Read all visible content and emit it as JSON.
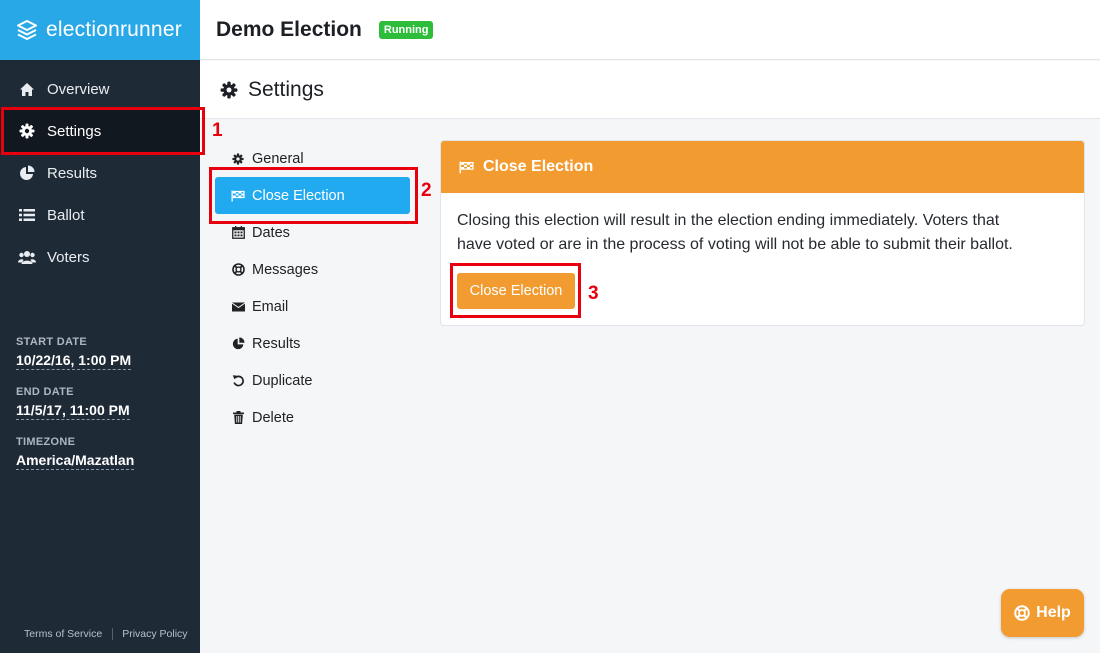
{
  "app": {
    "logo_text": "electionrunner"
  },
  "sidebar": {
    "items": [
      {
        "label": "Overview",
        "icon": "home-icon"
      },
      {
        "label": "Settings",
        "icon": "gear-icon",
        "active": true
      },
      {
        "label": "Results",
        "icon": "pie-chart-icon"
      },
      {
        "label": "Ballot",
        "icon": "list-icon"
      },
      {
        "label": "Voters",
        "icon": "users-icon"
      }
    ],
    "meta": {
      "start_label": "START DATE",
      "start_value": "10/22/16, 1:00 PM",
      "end_label": "END DATE",
      "end_value": "11/5/17, 11:00 PM",
      "tz_label": "TIMEZONE",
      "tz_value": "America/Mazatlan"
    },
    "footer": {
      "terms": "Terms of Service",
      "privacy": "Privacy Policy"
    }
  },
  "header": {
    "title": "Demo Election",
    "status": "Running"
  },
  "page": {
    "title": "Settings"
  },
  "subnav": {
    "items": [
      {
        "label": "General",
        "icon": "gear-icon"
      },
      {
        "label": "Close Election",
        "icon": "flag-icon",
        "active": true
      },
      {
        "label": "Dates",
        "icon": "calendar-icon"
      },
      {
        "label": "Messages",
        "icon": "lifebuoy-icon"
      },
      {
        "label": "Email",
        "icon": "envelope-icon"
      },
      {
        "label": "Results",
        "icon": "pie-chart-icon"
      },
      {
        "label": "Duplicate",
        "icon": "undo-icon"
      },
      {
        "label": "Delete",
        "icon": "trash-icon"
      }
    ]
  },
  "panel": {
    "title": "Close Election",
    "line1": "Closing this election will result in the election ending immediately. Voters that",
    "line2": "have voted or are in the process of voting will not be able to submit their ballot.",
    "button": "Close Election"
  },
  "annotations": [
    "1",
    "2",
    "3"
  ],
  "help": {
    "label": "Help"
  },
  "colors": {
    "sidebar": "#1f2a37",
    "brand": "#29a8e8",
    "accent": "#f29b31",
    "active": "#22aaf0",
    "running": "#2ebd3a",
    "highlight": "#e8000e"
  }
}
